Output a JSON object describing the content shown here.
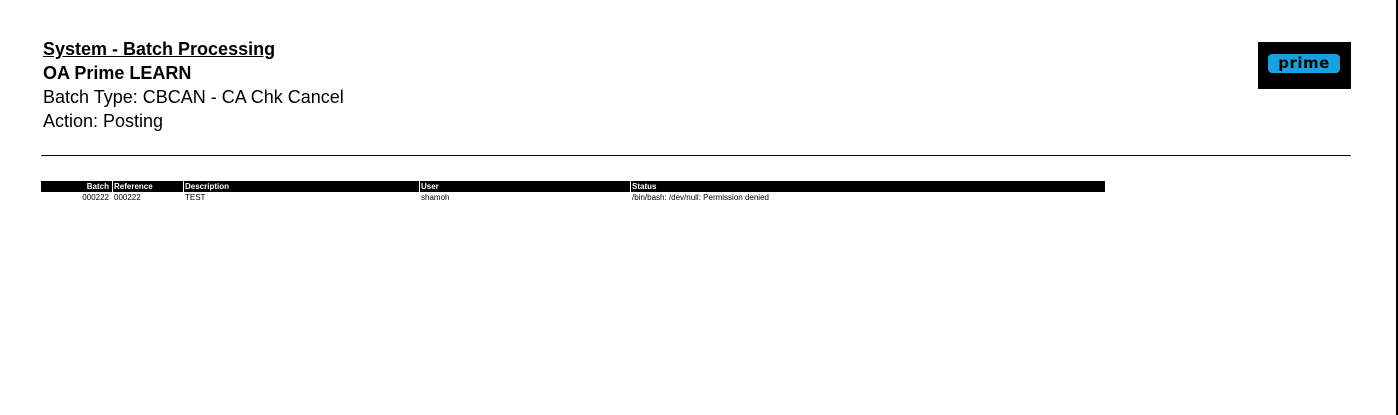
{
  "header": {
    "report_title": "System - Batch Processing",
    "company": "OA Prime LEARN",
    "batch_type": "Batch Type: CBCAN - CA Chk Cancel",
    "action": "Action: Posting"
  },
  "logo": {
    "text": "prime",
    "background_color": "#000000",
    "accent_color": "#1aa0dc"
  },
  "table": {
    "columns": {
      "batch": "Batch",
      "reference": "Reference",
      "description": "Description",
      "user": "User",
      "status": "Status"
    },
    "rows": [
      {
        "batch": "000222",
        "reference": "000222",
        "description": "TEST",
        "user": "shamoh",
        "status": "/bin/bash: /dev/null: Permission denied"
      }
    ]
  }
}
